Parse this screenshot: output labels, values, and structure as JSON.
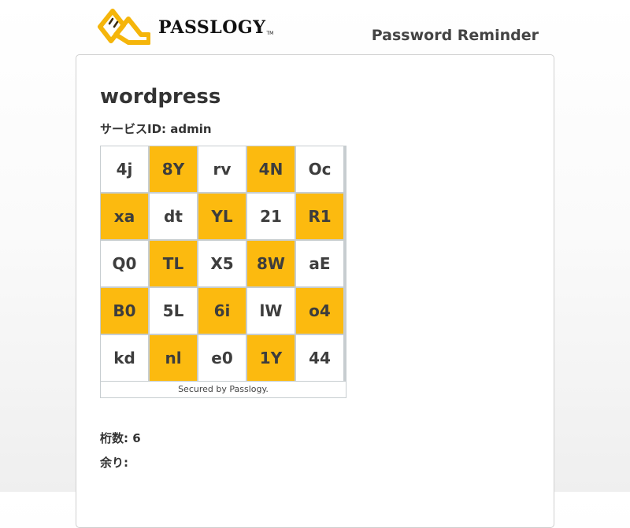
{
  "header": {
    "logo_text": "PASSLOGY",
    "logo_tm": "TM",
    "title": "Password Reminder"
  },
  "main": {
    "service_name": "wordpress",
    "service_id": "サービスID: admin",
    "matrix": {
      "rows": [
        [
          "4j",
          "8Y",
          "rv",
          "4N",
          "Oc"
        ],
        [
          "xa",
          "dt",
          "YL",
          "21",
          "R1"
        ],
        [
          "Q0",
          "TL",
          "X5",
          "8W",
          "aE"
        ],
        [
          "B0",
          "5L",
          "6i",
          "lW",
          "o4"
        ],
        [
          "kd",
          "nl",
          "e0",
          "1Y",
          "44"
        ]
      ],
      "footer": "Secured by Passlogy."
    },
    "digits": "桁数: 6",
    "remainder": "余り:"
  },
  "colors": {
    "accent": "#fcba0f",
    "cell_white": "#ffffff",
    "grid_border": "#c7cdd0"
  }
}
